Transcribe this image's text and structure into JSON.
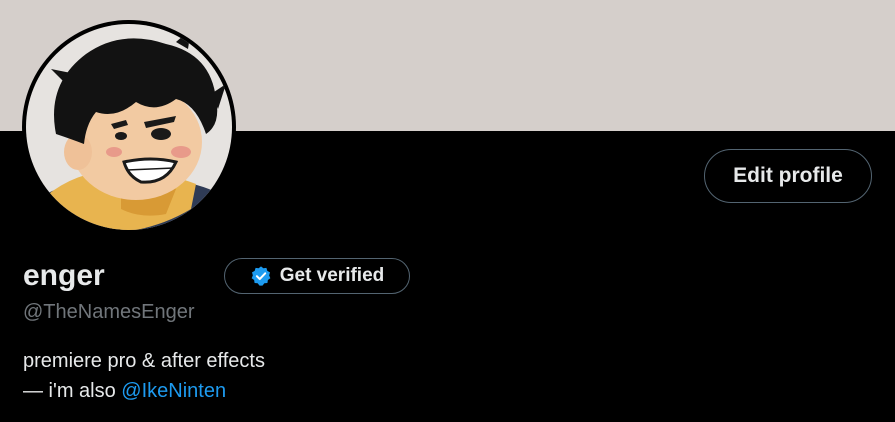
{
  "colors": {
    "banner": "#d5cfcb",
    "background": "#000000",
    "text_primary": "#e7e9ea",
    "text_secondary": "#71767b",
    "link": "#1d9bf0",
    "button_border": "#536471",
    "verified_badge": "#1d9bf0"
  },
  "profile": {
    "display_name": "enger",
    "handle": "@TheNamesEnger",
    "bio_line1": "premiere pro & after effects",
    "bio_line2_prefix": "— i'm also ",
    "bio_mention": "@IkeNinten"
  },
  "actions": {
    "edit_profile_label": "Edit profile",
    "get_verified_label": "Get verified",
    "get_verified_icon": "verified-badge-icon"
  }
}
